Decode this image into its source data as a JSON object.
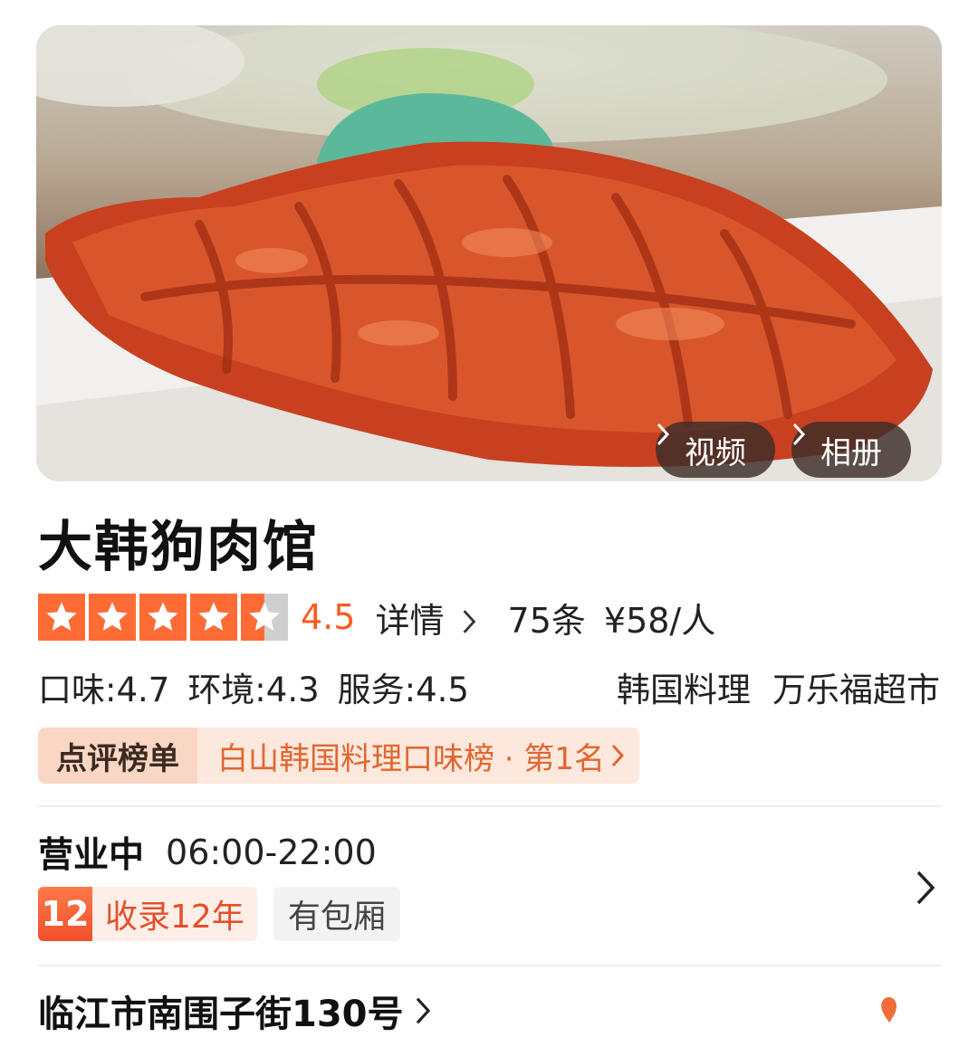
{
  "hero": {
    "video_label": "视频",
    "album_label": "相册"
  },
  "shop": {
    "name": "大韩狗肉馆",
    "rating": "4.5",
    "stars_value": 4.5,
    "details_label": "详情",
    "review_count": "75条",
    "price_per_person": "¥58/人",
    "taste": "口味:4.7",
    "environment": "环境:4.3",
    "service": "服务:4.5",
    "cuisine": "韩国料理",
    "area": "万乐福超市"
  },
  "rank": {
    "label": "点评榜单",
    "text": "白山韩国料理口味榜 · 第1名"
  },
  "hours": {
    "status": "营业中",
    "time": "06:00-22:00"
  },
  "tags": {
    "years_badge": "12",
    "years_text": "收录12年",
    "room": "有包厢"
  },
  "address": {
    "text": "临江市南围子街130号"
  },
  "colors": {
    "accent": "#ff6b35",
    "rank_bg": "#fde8dd",
    "rank_text": "#e0662f"
  }
}
